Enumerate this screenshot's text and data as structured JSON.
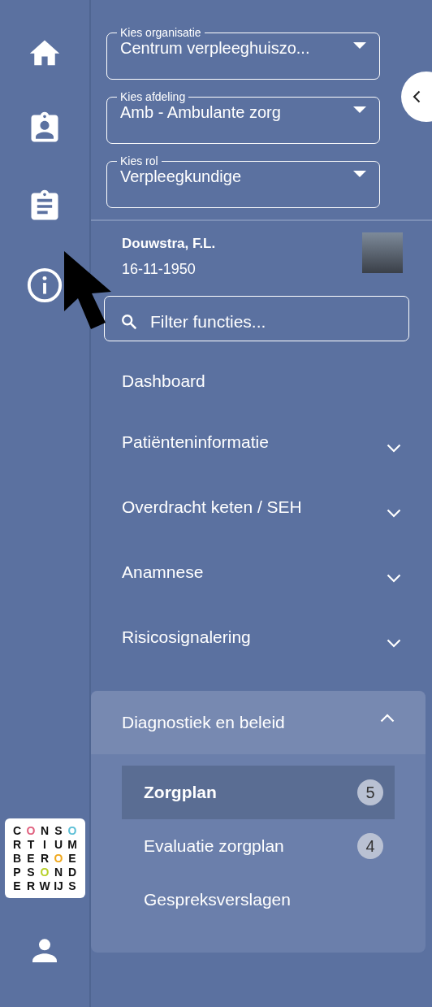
{
  "rail": {
    "items": [
      {
        "kind": "home"
      },
      {
        "kind": "badge"
      },
      {
        "kind": "clipboard"
      },
      {
        "kind": "info"
      }
    ],
    "logo": {
      "rows": [
        {
          "letters": [
            {
              "t": "C"
            },
            {
              "t": "O",
              "color": "#e0607e"
            },
            {
              "t": "N"
            },
            {
              "t": "S"
            },
            {
              "t": "O",
              "color": "#5bbfd6"
            }
          ]
        },
        {
          "letters": [
            {
              "t": "R"
            },
            {
              "t": "T"
            },
            {
              "t": "I"
            },
            {
              "t": "U"
            },
            {
              "t": "M"
            }
          ]
        },
        {
          "letters": [
            {
              "t": "B"
            },
            {
              "t": "E"
            },
            {
              "t": "R"
            },
            {
              "t": "O",
              "color": "#f0a81c"
            },
            {
              "t": "E"
            }
          ]
        },
        {
          "letters": [
            {
              "t": "P"
            },
            {
              "t": "S"
            },
            {
              "t": "O",
              "color": "#b8d12a"
            },
            {
              "t": "N"
            },
            {
              "t": "D"
            }
          ]
        },
        {
          "letters": [
            {
              "t": "E"
            },
            {
              "t": "R"
            },
            {
              "t": "W"
            },
            {
              "t": "IJ"
            },
            {
              "t": "S"
            }
          ]
        }
      ]
    }
  },
  "selects": [
    {
      "label": "Kies organisatie",
      "value": "Centrum verpleeghuiszo..."
    },
    {
      "label": "Kies afdeling",
      "value": "Amb - Ambulante zorg"
    },
    {
      "label": "Kies rol",
      "value": "Verpleegkundige"
    }
  ],
  "patient": {
    "name": "Douwstra, F.L.",
    "birthdate": "16-11-1950"
  },
  "filter": {
    "placeholder": "Filter functies..."
  },
  "menu": [
    {
      "label": "Dashboard",
      "expandable": false,
      "expanded": false
    },
    {
      "label": "Patiënteninformatie",
      "expandable": true,
      "expanded": false
    },
    {
      "label": "Overdracht keten / SEH",
      "expandable": true,
      "expanded": false
    },
    {
      "label": "Anamnese",
      "expandable": true,
      "expanded": false
    },
    {
      "label": "Risicosignalering",
      "expandable": true,
      "expanded": false
    },
    {
      "label": "Diagnostiek en beleid",
      "expandable": true,
      "expanded": true,
      "children": [
        {
          "label": "Zorgplan",
          "count": "5",
          "selected": true
        },
        {
          "label": "Evaluatie zorgplan",
          "count": "4",
          "selected": false
        },
        {
          "label": "Gespreksverslagen",
          "selected": false
        }
      ]
    }
  ]
}
